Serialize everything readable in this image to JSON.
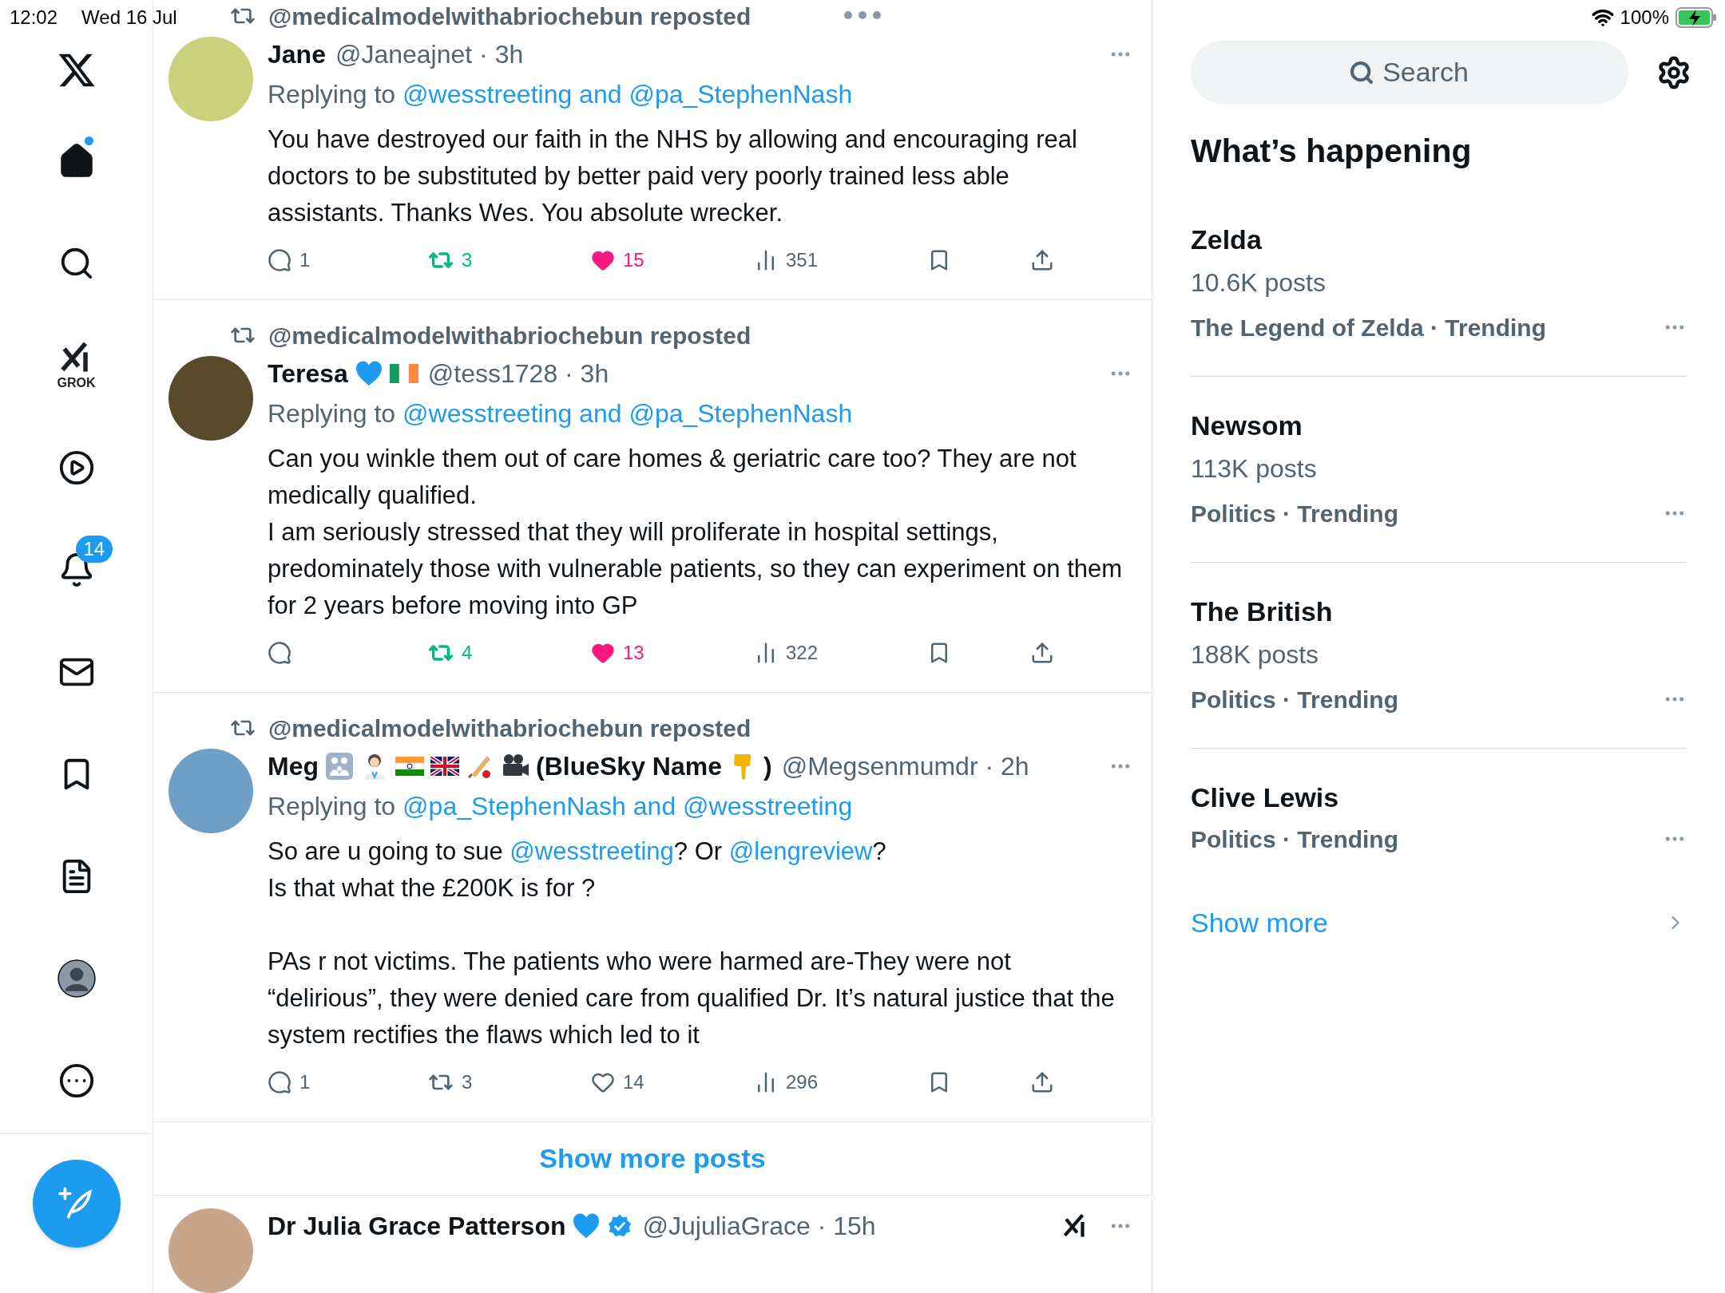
{
  "status_bar": {
    "time": "12:02",
    "date": "Wed 16 Jul",
    "battery": "100%"
  },
  "nav": {
    "items": [
      {
        "kind": "home",
        "selected": true,
        "unread": true
      },
      {
        "kind": "search",
        "selected": false
      },
      {
        "kind": "grok",
        "selected": false,
        "label": "GROK"
      },
      {
        "kind": "video",
        "selected": false
      },
      {
        "kind": "notifications",
        "selected": false,
        "badge": "14"
      },
      {
        "kind": "messages",
        "selected": false
      },
      {
        "kind": "bookmarks",
        "selected": false
      },
      {
        "kind": "lists",
        "selected": false
      },
      {
        "kind": "profile",
        "selected": false
      },
      {
        "kind": "more",
        "selected": false
      }
    ]
  },
  "feed": {
    "tweets": [
      {
        "kind": "full",
        "reposted_by": "@medicalmodelwithabriochebun reposted",
        "name_parts": [
          {
            "kind": "text",
            "text": "Jane"
          }
        ],
        "handle": "@Janeajnet · 3h",
        "replying_label": "Replying to",
        "replying_to": "@wesstreeting and @pa_StephenNash",
        "body": [
          {
            "spaced": false,
            "segments": [
              {
                "text": "You have destroyed our faith in the NHS by allowing and encouraging real doctors to be substituted by better paid very poorly trained less able assistants. Thanks Wes. You absolute wrecker.",
                "link": false
              }
            ]
          }
        ],
        "actions": {
          "replies": "1",
          "reposts": "3",
          "likes": "15",
          "views": "351",
          "reposted": true,
          "liked": true
        }
      },
      {
        "kind": "full",
        "reposted_by": "@medicalmodelwithabriochebun reposted",
        "name_parts": [
          {
            "kind": "text",
            "text": "Teresa"
          },
          {
            "kind": "heart"
          },
          {
            "kind": "ireland"
          }
        ],
        "handle": "@tess1728 · 3h",
        "replying_label": "Replying to",
        "replying_to": "@wesstreeting and @pa_StephenNash",
        "body": [
          {
            "spaced": false,
            "segments": [
              {
                "text": "Can you winkle them out of care homes & geriatric care too? They are not medically qualified.",
                "link": false
              }
            ]
          },
          {
            "spaced": false,
            "segments": [
              {
                "text": "I am seriously stressed that they will proliferate in hospital settings, predominately those with vulnerable patients, so they can experiment on them for 2 years before moving into GP",
                "link": false
              }
            ]
          }
        ],
        "actions": {
          "reposts": "4",
          "likes": "13",
          "views": "322",
          "reposted": true,
          "liked": true
        }
      },
      {
        "kind": "full",
        "reposted_by": "@medicalmodelwithabriochebun reposted",
        "name_parts": [
          {
            "kind": "text",
            "text": "Meg"
          },
          {
            "kind": "family"
          },
          {
            "kind": "doctor"
          },
          {
            "kind": "india"
          },
          {
            "kind": "uk"
          },
          {
            "kind": "cricket"
          },
          {
            "kind": "camera"
          },
          {
            "kind": "text",
            "text": "(BlueSky Name"
          },
          {
            "kind": "pointer"
          },
          {
            "kind": "text",
            "text": ")"
          }
        ],
        "handle": "@Megsenmumdr · 2h",
        "replying_label": "Replying to",
        "replying_to": "@pa_StephenNash and @wesstreeting",
        "body": [
          {
            "spaced": false,
            "segments": [
              {
                "text": "So are u going to sue ",
                "link": false
              },
              {
                "text": "@wesstreeting",
                "link": true
              },
              {
                "text": "? Or ",
                "link": false
              },
              {
                "text": "@lengreview",
                "link": true
              },
              {
                "text": "?",
                "link": false
              }
            ]
          },
          {
            "spaced": false,
            "segments": [
              {
                "text": "Is that what the £200K is for ?",
                "link": false
              }
            ]
          },
          {
            "spaced": true,
            "segments": [
              {
                "text": "PAs r not victims. The patients who were harmed are-They were not “delirious”, they were denied care from qualified Dr. It’s natural justice that the system rectifies the flaws which led to it",
                "link": false
              }
            ]
          }
        ],
        "actions": {
          "replies": "1",
          "reposts": "3",
          "likes": "14",
          "views": "296",
          "reposted": false,
          "liked": false
        }
      },
      {
        "kind": "cut",
        "name_parts": [
          {
            "kind": "text",
            "text": "Dr Julia Grace Patterson"
          },
          {
            "kind": "heart"
          },
          {
            "kind": "verified"
          }
        ],
        "handle": "@JujuliaGrace · 15h"
      }
    ],
    "show_more": "Show more posts"
  },
  "sidebar": {
    "search_placeholder": "Search",
    "heading": "What’s happening",
    "trends": [
      {
        "title": "Zelda",
        "posts": "10.6K posts",
        "meta": "The Legend of Zelda · Trending"
      },
      {
        "title": "Newsom",
        "posts": "113K posts",
        "meta": "Politics · Trending"
      },
      {
        "title": "The British",
        "posts": "188K posts",
        "meta": "Politics · Trending"
      },
      {
        "title": "Clive Lewis",
        "meta": "Politics · Trending"
      }
    ],
    "show_more": "Show more"
  }
}
